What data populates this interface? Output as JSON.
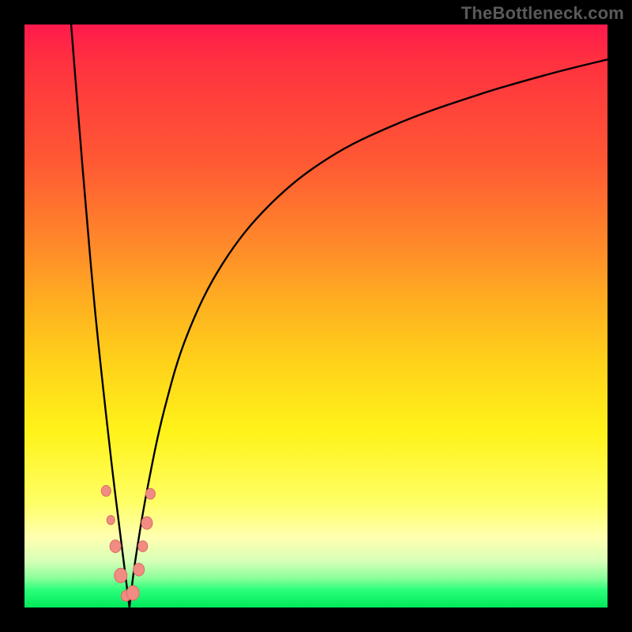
{
  "watermark": "TheBottleneck.com",
  "colors": {
    "frame": "#000000",
    "curve": "#000000",
    "marker_fill": "#f08c82",
    "marker_stroke": "#d86e64"
  },
  "chart_data": {
    "type": "line",
    "title": "",
    "xlabel": "",
    "ylabel": "",
    "xlim": [
      0,
      100
    ],
    "ylim": [
      0,
      100
    ],
    "x_optimal": 18,
    "note": "V-shaped bottleneck curve. Values are visual estimates (percent of plot width/height). Vertex near x≈18 at y≈0; left branch rises to ≈100 at x≈8; right branch rises asymptotically toward ≈94 at x=100.",
    "left_branch": {
      "x": [
        8,
        10,
        12,
        14,
        15.5,
        17,
        18
      ],
      "y": [
        100,
        75,
        52,
        33,
        20,
        8,
        0
      ]
    },
    "right_branch": {
      "x": [
        18,
        19,
        21,
        24,
        28,
        34,
        42,
        52,
        64,
        78,
        90,
        100
      ],
      "y": [
        0,
        8,
        20,
        34,
        47,
        59,
        69,
        77,
        83,
        88,
        91.5,
        94
      ]
    },
    "series": [
      {
        "name": "markers",
        "type": "scatter",
        "x": [
          14.0,
          14.8,
          15.6,
          16.5,
          17.4,
          18.6,
          19.6,
          20.3,
          21.0,
          21.6
        ],
        "y": [
          20.0,
          15.0,
          10.5,
          5.5,
          2.0,
          2.5,
          6.5,
          10.5,
          14.5,
          19.5
        ],
        "r": [
          6,
          5,
          7,
          8,
          6,
          8,
          7,
          6,
          7,
          6
        ]
      }
    ]
  }
}
